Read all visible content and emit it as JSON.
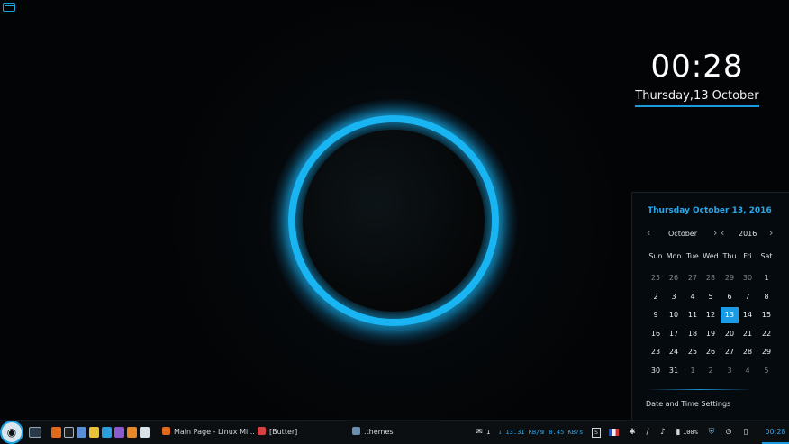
{
  "clock": {
    "time": "00:28",
    "date": "Thursday,13 October"
  },
  "calendar": {
    "header": "Thursday October 13, 2016",
    "month": "October",
    "year": "2016",
    "weekdays": [
      "Sun",
      "Mon",
      "Tue",
      "Wed",
      "Thu",
      "Fri",
      "Sat"
    ],
    "weeks": [
      [
        "25",
        "26",
        "27",
        "28",
        "29",
        "30",
        "1"
      ],
      [
        "2",
        "3",
        "4",
        "5",
        "6",
        "7",
        "8"
      ],
      [
        "9",
        "10",
        "11",
        "12",
        "13",
        "14",
        "15"
      ],
      [
        "16",
        "17",
        "18",
        "19",
        "20",
        "21",
        "22"
      ],
      [
        "23",
        "24",
        "25",
        "26",
        "27",
        "28",
        "29"
      ],
      [
        "30",
        "31",
        "1",
        "2",
        "3",
        "4",
        "5"
      ]
    ],
    "selected_day": "13",
    "settings_label": "Date and Time Settings"
  },
  "taskbar": {
    "tasks": [
      {
        "label": "Main Page - Linux Mi...",
        "icon": "firefox-icon"
      },
      {
        "label": "[Butter]",
        "icon": "popcorn-icon"
      },
      {
        "label": ".themes",
        "icon": "folder-icon"
      }
    ],
    "notifications_count": "1",
    "net_down": "↓ 13.31 KB/s",
    "net_up": "↑ 0.45 KB/s",
    "battery": "100%",
    "clock": "00:28"
  },
  "colors": {
    "accent": "#19b4f2",
    "background": "#030405",
    "panel": "#0b0f12"
  }
}
